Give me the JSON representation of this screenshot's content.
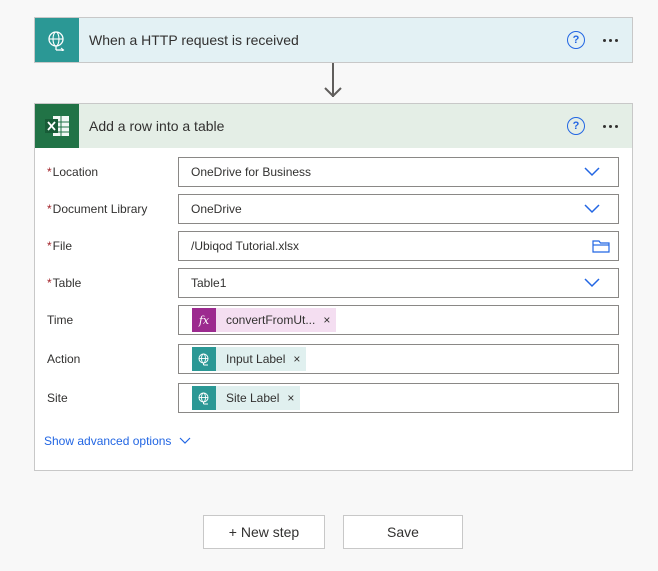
{
  "trigger": {
    "title": "When a HTTP request is received",
    "icon": "http-globe-icon",
    "help": "?"
  },
  "action": {
    "title": "Add a row into a table",
    "icon": "excel-icon",
    "help": "?",
    "fields": [
      {
        "label": "Location",
        "required": true,
        "value": "OneDrive for Business",
        "control": "dropdown"
      },
      {
        "label": "Document Library",
        "required": true,
        "value": "OneDrive",
        "control": "dropdown"
      },
      {
        "label": "File",
        "required": true,
        "value": "/Ubiqod Tutorial.xlsx",
        "control": "file-picker"
      },
      {
        "label": "Table",
        "required": true,
        "value": "Table1",
        "control": "dropdown"
      },
      {
        "label": "Time",
        "required": false,
        "token": "convertFromUt...",
        "token_type": "expression"
      },
      {
        "label": "Action",
        "required": false,
        "token": "Input Label",
        "token_type": "dynamic"
      },
      {
        "label": "Site",
        "required": false,
        "token": "Site Label",
        "token_type": "dynamic"
      }
    ],
    "required_mark": "*",
    "remove_mark": "×",
    "fx": "fx",
    "advanced_link": "Show advanced options"
  },
  "buttons": {
    "new_step": "+ New step",
    "save": "Save"
  },
  "colors": {
    "trigger_header": "#e3f1f4",
    "trigger_icon": "#2b9895",
    "action_header": "#e4eee6",
    "excel_green": "#217346",
    "expression_purple": "#9c2a8f",
    "link_blue": "#2266e3",
    "required_red": "#a4262c"
  }
}
